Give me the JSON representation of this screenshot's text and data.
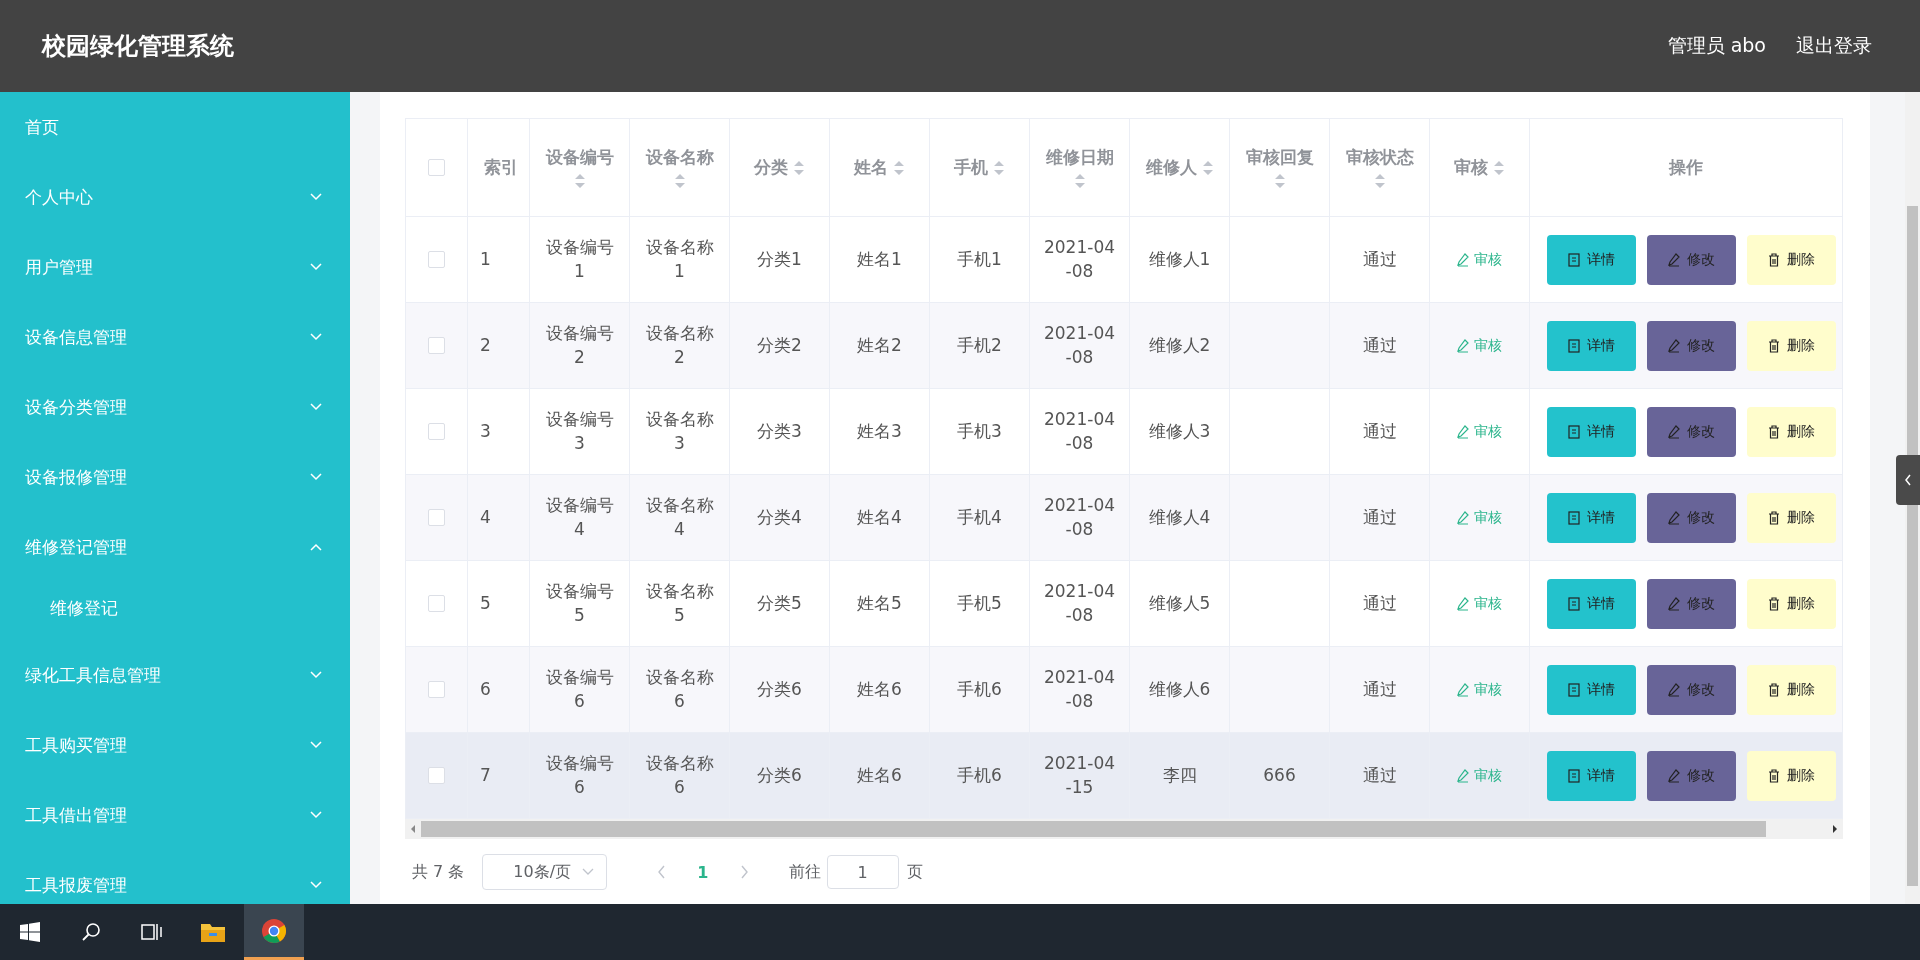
{
  "header": {
    "title": "校园绿化管理系统",
    "user": "管理员 abo",
    "logout": "退出登录"
  },
  "sidebar": {
    "items": [
      {
        "label": "首页",
        "expandable": false
      },
      {
        "label": "个人中心",
        "expandable": true,
        "expanded": false
      },
      {
        "label": "用户管理",
        "expandable": true,
        "expanded": false
      },
      {
        "label": "设备信息管理",
        "expandable": true,
        "expanded": false
      },
      {
        "label": "设备分类管理",
        "expandable": true,
        "expanded": false
      },
      {
        "label": "设备报修管理",
        "expandable": true,
        "expanded": false
      },
      {
        "label": "维修登记管理",
        "expandable": true,
        "expanded": true,
        "children": [
          {
            "label": "维修登记"
          }
        ]
      },
      {
        "label": "绿化工具信息管理",
        "expandable": true,
        "expanded": false
      },
      {
        "label": "工具购买管理",
        "expandable": true,
        "expanded": false
      },
      {
        "label": "工具借出管理",
        "expandable": true,
        "expanded": false
      },
      {
        "label": "工具报废管理",
        "expandable": true,
        "expanded": false
      }
    ]
  },
  "table": {
    "select_all_checked": false,
    "columns": [
      {
        "label": "索引",
        "sortable": false
      },
      {
        "label": "设备编号",
        "sortable": true
      },
      {
        "label": "设备名称",
        "sortable": true
      },
      {
        "label": "分类",
        "sortable": true
      },
      {
        "label": "姓名",
        "sortable": true
      },
      {
        "label": "手机",
        "sortable": true
      },
      {
        "label": "维修日期",
        "sortable": true
      },
      {
        "label": "维修人",
        "sortable": true
      },
      {
        "label": "审核回复",
        "sortable": true
      },
      {
        "label": "审核状态",
        "sortable": true
      },
      {
        "label": "审核",
        "sortable": true
      },
      {
        "label": "操作",
        "sortable": false
      }
    ],
    "rows": [
      {
        "checked": false,
        "hovered": false,
        "cells": [
          "1",
          "设备编号1",
          "设备名称1",
          "分类1",
          "姓名1",
          "手机1",
          "2021-04-08",
          "维修人1",
          "",
          "通过"
        ],
        "review": "审核",
        "actions": [
          "详情",
          "修改",
          "删除"
        ]
      },
      {
        "checked": false,
        "hovered": false,
        "cells": [
          "2",
          "设备编号2",
          "设备名称2",
          "分类2",
          "姓名2",
          "手机2",
          "2021-04-08",
          "维修人2",
          "",
          "通过"
        ],
        "review": "审核",
        "actions": [
          "详情",
          "修改",
          "删除"
        ]
      },
      {
        "checked": false,
        "hovered": false,
        "cells": [
          "3",
          "设备编号3",
          "设备名称3",
          "分类3",
          "姓名3",
          "手机3",
          "2021-04-08",
          "维修人3",
          "",
          "通过"
        ],
        "review": "审核",
        "actions": [
          "详情",
          "修改",
          "删除"
        ]
      },
      {
        "checked": false,
        "hovered": false,
        "cells": [
          "4",
          "设备编号4",
          "设备名称4",
          "分类4",
          "姓名4",
          "手机4",
          "2021-04-08",
          "维修人4",
          "",
          "通过"
        ],
        "review": "审核",
        "actions": [
          "详情",
          "修改",
          "删除"
        ]
      },
      {
        "checked": false,
        "hovered": false,
        "cells": [
          "5",
          "设备编号5",
          "设备名称5",
          "分类5",
          "姓名5",
          "手机5",
          "2021-04-08",
          "维修人5",
          "",
          "通过"
        ],
        "review": "审核",
        "actions": [
          "详情",
          "修改",
          "删除"
        ]
      },
      {
        "checked": false,
        "hovered": false,
        "cells": [
          "6",
          "设备编号6",
          "设备名称6",
          "分类6",
          "姓名6",
          "手机6",
          "2021-04-08",
          "维修人6",
          "",
          "通过"
        ],
        "review": "审核",
        "actions": [
          "详情",
          "修改",
          "删除"
        ]
      },
      {
        "checked": false,
        "hovered": true,
        "cells": [
          "7",
          "设备编号6",
          "设备名称6",
          "分类6",
          "姓名6",
          "手机6",
          "2021-04-15",
          "李四",
          "666",
          "通过"
        ],
        "review": "审核",
        "actions": [
          "详情",
          "修改",
          "删除"
        ]
      }
    ]
  },
  "pagination": {
    "total": "共 7 条",
    "page_size": "10条/页",
    "pages": [
      {
        "label": "1",
        "selected": true
      }
    ],
    "goto_label": "前往",
    "goto_value": "1",
    "goto_suffix": "页"
  },
  "taskbar": {
    "items": [
      {
        "kind": "start",
        "selected": false
      },
      {
        "kind": "search",
        "selected": false
      },
      {
        "kind": "taskview",
        "selected": false
      },
      {
        "kind": "folder",
        "selected": false
      },
      {
        "kind": "browser",
        "selected": true
      }
    ]
  }
}
